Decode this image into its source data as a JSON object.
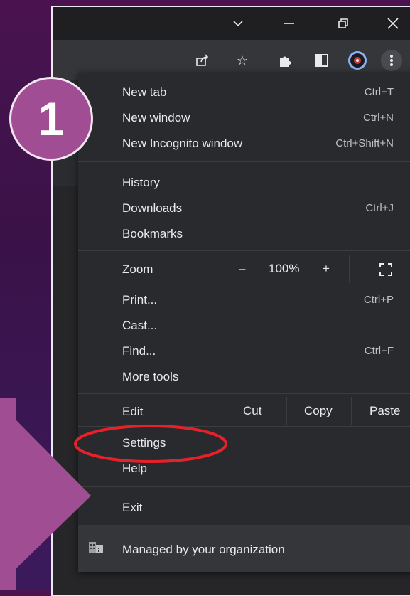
{
  "step_badge": {
    "number": "1"
  },
  "menu": {
    "new_tab": {
      "label": "New tab",
      "shortcut": "Ctrl+T"
    },
    "new_window": {
      "label": "New window",
      "shortcut": "Ctrl+N"
    },
    "new_incognito": {
      "label": "New Incognito window",
      "shortcut": "Ctrl+Shift+N"
    },
    "history": {
      "label": "History"
    },
    "downloads": {
      "label": "Downloads",
      "shortcut": "Ctrl+J"
    },
    "bookmarks": {
      "label": "Bookmarks"
    },
    "zoom": {
      "label": "Zoom",
      "minus": "–",
      "value": "100%",
      "plus": "+"
    },
    "print": {
      "label": "Print...",
      "shortcut": "Ctrl+P"
    },
    "cast": {
      "label": "Cast..."
    },
    "find": {
      "label": "Find...",
      "shortcut": "Ctrl+F"
    },
    "more_tools": {
      "label": "More tools"
    },
    "edit": {
      "label": "Edit",
      "cut": "Cut",
      "copy": "Copy",
      "paste": "Paste"
    },
    "settings": {
      "label": "Settings"
    },
    "help": {
      "label": "Help"
    },
    "exit": {
      "label": "Exit"
    },
    "managed": {
      "label": "Managed by your organization"
    }
  },
  "colors": {
    "background": "#4a1350",
    "badge": "#a14d93",
    "highlight_ellipse": "#e8202a",
    "arrow": "#a14d93",
    "menu_bg": "#292a2d"
  }
}
